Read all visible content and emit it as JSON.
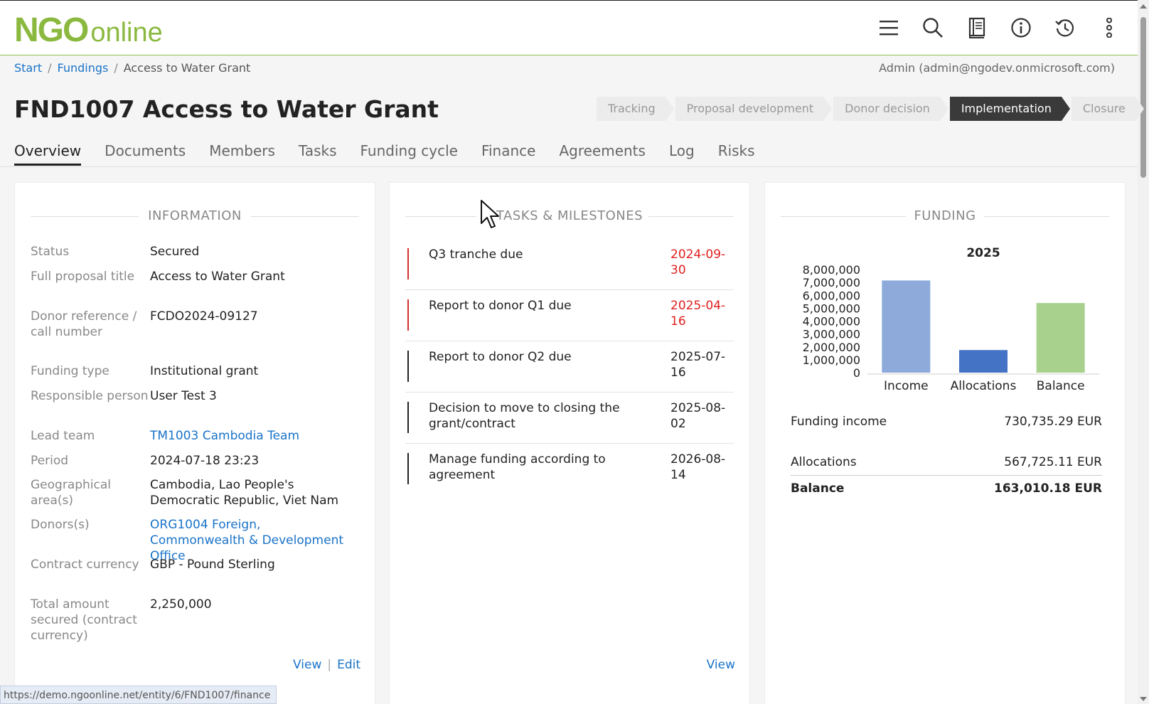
{
  "header": {
    "logo_main": "NGO",
    "logo_sub": "online",
    "brand_color": "#8bb93f",
    "icons": [
      "menu-icon",
      "search-icon",
      "book-icon",
      "info-icon",
      "history-icon",
      "more-vert-icon"
    ]
  },
  "breadcrumb": {
    "start": "Start",
    "sep": "/",
    "fundings": "Fundings",
    "current": "Access to Water Grant"
  },
  "user": "Admin (admin@ngodev.onmicrosoft.com)",
  "page_title": "FND1007 Access to Water Grant",
  "stages": [
    "Tracking",
    "Proposal development",
    "Donor decision",
    "Implementation",
    "Closure"
  ],
  "active_stage": "Implementation",
  "tabs": [
    "Overview",
    "Documents",
    "Members",
    "Tasks",
    "Funding cycle",
    "Finance",
    "Agreements",
    "Log",
    "Risks"
  ],
  "information": {
    "heading": "INFORMATION",
    "rows": [
      {
        "label": "Status",
        "value": "Secured"
      },
      {
        "label": "Full proposal title",
        "value": "Access to Water Grant"
      },
      {
        "label": "Donor reference / call number",
        "value": "FCDO2024-09127"
      },
      {
        "label": "Funding type",
        "value": "Institutional grant"
      },
      {
        "label": "Responsible person",
        "value": "User Test 3"
      },
      {
        "label": "Lead team",
        "value": "TM1003 Cambodia Team"
      },
      {
        "label": "Period",
        "value": "2024-07-18 23:23"
      },
      {
        "label": "Geographical area(s)",
        "value": "Cambodia, Lao People's Democratic Republic, Viet Nam"
      },
      {
        "label": "Donors(s)",
        "value": "ORG1004 Foreign, Commonwealth & Development Office"
      },
      {
        "label": "Contract currency",
        "value": "GBP - Pound Sterling"
      },
      {
        "label": "Total amount secured (contract currency)",
        "value": "2,250,000"
      }
    ],
    "view": "View",
    "edit": "Edit",
    "sep": "|"
  },
  "tasks": {
    "heading": "TASKS & MILESTONES",
    "items": [
      {
        "name": "Q3 tranche due",
        "date": "2024-09-30",
        "overdue": true
      },
      {
        "name": "Report to donor Q1 due",
        "date": "2025-04-16",
        "overdue": true
      },
      {
        "name": "Report to donor Q2 due",
        "date": "2025-07-16",
        "overdue": false
      },
      {
        "name": "Decision to move to closing the grant/contract",
        "date": "2025-08-02",
        "overdue": false
      },
      {
        "name": "Manage funding according to agreement",
        "date": "2026-08-14",
        "overdue": false
      }
    ],
    "view": "View"
  },
  "funding": {
    "heading": "FUNDING",
    "rows": [
      {
        "label": "Funding income",
        "value": "730,735.29 EUR"
      },
      {
        "label": "Allocations",
        "value": "567,725.11 EUR"
      },
      {
        "label": "Balance",
        "value": "163,010.18 EUR"
      }
    ]
  },
  "chart_data": {
    "type": "bar",
    "title": "2025",
    "categories": [
      "Income",
      "Allocations",
      "Balance"
    ],
    "values": [
      7150000,
      1750000,
      5400000
    ],
    "colors": [
      "#8eaadb",
      "#4472c4",
      "#a9d18e"
    ],
    "ylim": [
      0,
      8000000
    ],
    "yticks": [
      "8,000,000",
      "7,000,000",
      "6,000,000",
      "5,000,000",
      "4,000,000",
      "3,000,000",
      "2,000,000",
      "1,000,000",
      "0"
    ],
    "grid": false,
    "legend": "none"
  },
  "status_url": "https://demo.ngoonline.net/entity/6/FND1007/finance",
  "colors": {
    "link": "#1a73c8",
    "overdue": "#e02020",
    "active_stage": "#3a3a3a"
  }
}
